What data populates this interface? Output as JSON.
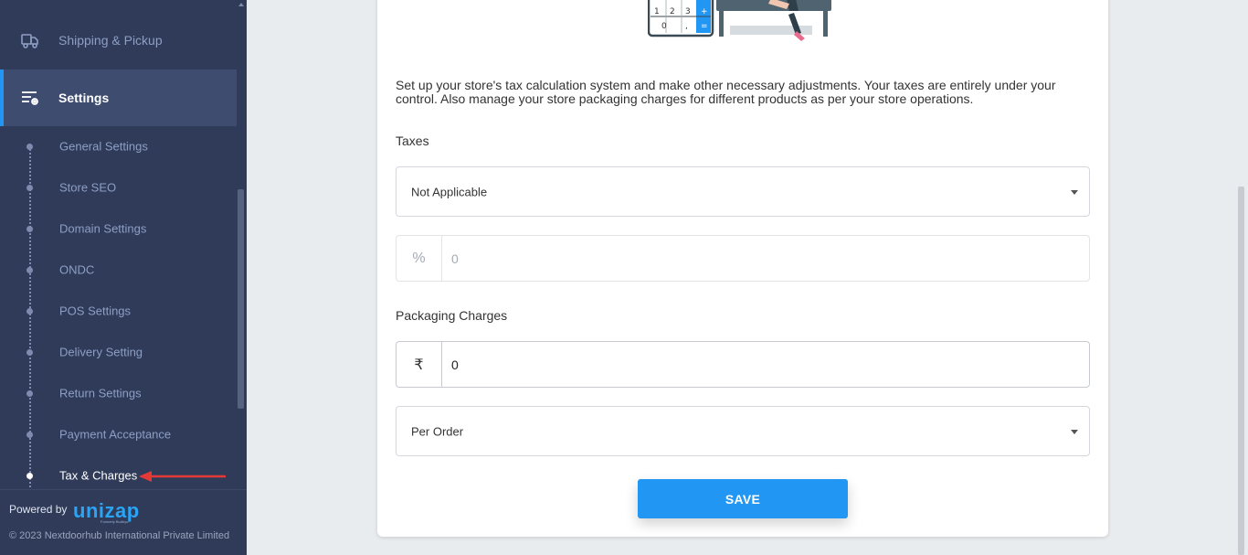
{
  "sidebar": {
    "nav": {
      "shipping": {
        "label": "Shipping & Pickup",
        "icon": "truck-icon"
      },
      "settings": {
        "label": "Settings",
        "icon": "settings-sliders-icon"
      }
    },
    "sub_items": [
      {
        "label": "General Settings",
        "active": false
      },
      {
        "label": "Store SEO",
        "active": false
      },
      {
        "label": "Domain Settings",
        "active": false
      },
      {
        "label": "ONDC",
        "active": false
      },
      {
        "label": "POS Settings",
        "active": false
      },
      {
        "label": "Delivery Setting",
        "active": false
      },
      {
        "label": "Return Settings",
        "active": false
      },
      {
        "label": "Payment Acceptance",
        "active": false
      },
      {
        "label": "Tax & Charges",
        "active": true
      }
    ],
    "footer": {
      "powered_by": "Powered by",
      "logo_text": "unizap",
      "logo_subtext": "Formerly Bodhyo",
      "copyright": "© 2023 Nextdoorhub International Private Limited"
    }
  },
  "main": {
    "illustration": {
      "calculator_keys": [
        "1",
        "2",
        "3",
        "+",
        "0",
        ",",
        "="
      ]
    },
    "description": "Set up your store's tax calculation system and make other necessary adjustments. Your taxes are entirely under your control. Also manage your store packaging charges for different products as per your store operations.",
    "taxes": {
      "label": "Taxes",
      "select_value": "Not Applicable",
      "percent_symbol": "%",
      "percent_value": "0"
    },
    "packaging": {
      "label": "Packaging Charges",
      "currency_symbol": "₹",
      "amount_value": "0",
      "select_value": "Per Order"
    },
    "save_label": "SAVE"
  },
  "colors": {
    "sidebar_bg": "#2f3b59",
    "sidebar_active_bg": "#3e4c70",
    "accent": "#2196f3",
    "arrow": "#e53935"
  }
}
